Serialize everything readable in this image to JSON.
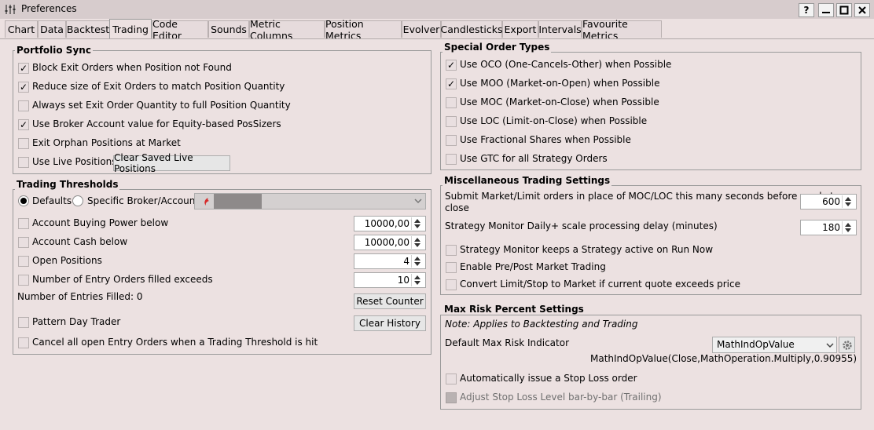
{
  "window": {
    "title": "Preferences",
    "buttons": {
      "help": "?",
      "minimize": "—",
      "maximize": "□",
      "close": "✕"
    }
  },
  "tabs": [
    "Chart",
    "Data",
    "Backtest",
    "Trading",
    "Code Editor",
    "Sounds",
    "Metric Columns",
    "Position Metrics",
    "Evolver",
    "Candlesticks",
    "Export",
    "Intervals",
    "Favourite Metrics"
  ],
  "active_tab": "Trading",
  "portfolio_sync": {
    "title": "Portfolio Sync",
    "options": [
      {
        "label": "Block Exit Orders when Position not Found",
        "checked": true
      },
      {
        "label": "Reduce size of Exit Orders to match Position Quantity",
        "checked": true
      },
      {
        "label": "Always set Exit Order Quantity to full Position Quantity",
        "checked": false
      },
      {
        "label": "Use Broker Account value for Equity-based PosSizers",
        "checked": true
      },
      {
        "label": "Exit Orphan Positions at Market",
        "checked": false
      },
      {
        "label": "Use Live Positions",
        "checked": false
      }
    ],
    "clear_button": "Clear Saved Live Positions"
  },
  "trading_thresholds": {
    "title": "Trading Thresholds",
    "radio_defaults": "Defaults",
    "radio_specific": "Specific Broker/Account",
    "selected": "Defaults",
    "rows": [
      {
        "label": "Account Buying Power below",
        "value": "10000,00",
        "checked": false
      },
      {
        "label": "Account Cash below",
        "value": "10000,00",
        "checked": false
      },
      {
        "label": "Open Positions",
        "value": "4",
        "checked": false
      },
      {
        "label": "Number of Entry Orders filled exceeds",
        "value": "10",
        "checked": false
      }
    ],
    "entries_filled": "Number of Entries Filled: 0",
    "reset_button": "Reset Counter",
    "pattern_day_trader": "Pattern Day Trader",
    "clear_history_button": "Clear History",
    "cancel_all": "Cancel all open Entry Orders when a Trading Threshold is hit"
  },
  "special_order_types": {
    "title": "Special Order Types",
    "options": [
      {
        "label": "Use OCO (One-Cancels-Other) when Possible",
        "checked": true
      },
      {
        "label": "Use MOO (Market-on-Open) when Possible",
        "checked": true
      },
      {
        "label": "Use MOC (Market-on-Close) when Possible",
        "checked": false
      },
      {
        "label": "Use LOC (Limit-on-Close) when Possible",
        "checked": false
      },
      {
        "label": "Use Fractional Shares when Possible",
        "checked": false
      },
      {
        "label": "Use GTC for all Strategy Orders",
        "checked": false
      }
    ]
  },
  "misc_settings": {
    "title": "Miscellaneous Trading Settings",
    "submit_label_line1": "Submit Market/Limit orders in place of MOC/LOC this many seconds before market",
    "submit_label_line2": "close",
    "submit_value": "600",
    "delay_label": "Strategy Monitor Daily+ scale processing delay (minutes)",
    "delay_value": "180",
    "options": [
      {
        "label": "Strategy Monitor keeps a Strategy active on Run Now",
        "checked": false
      },
      {
        "label": "Enable Pre/Post Market Trading",
        "checked": false
      },
      {
        "label": "Convert Limit/Stop to Market if current quote exceeds price",
        "checked": false
      }
    ]
  },
  "max_risk": {
    "title": "Max Risk Percent Settings",
    "note": "Note: Applies to Backtesting and Trading",
    "indicator_label": "Default Max Risk Indicator",
    "indicator_value": "MathIndOpValue",
    "expression": "MathIndOpValue(Close,MathOperation.Multiply,0.90955)",
    "auto_stop": {
      "label": "Automatically issue a Stop Loss order",
      "checked": false
    },
    "adjust_stop": {
      "label": "Adjust Stop Loss Level bar-by-bar (Trailing)",
      "checked": false,
      "disabled": true
    }
  },
  "icons": {
    "title": "sliders-icon",
    "check": "✓",
    "broker": "broker-logo-icon",
    "gear": "gear-icon",
    "dropdown": "chevron-down-icon"
  },
  "colors": {
    "background": "#ece1e1",
    "titlebar": "#d7cccd",
    "broker_logo": "#d62b2b"
  }
}
